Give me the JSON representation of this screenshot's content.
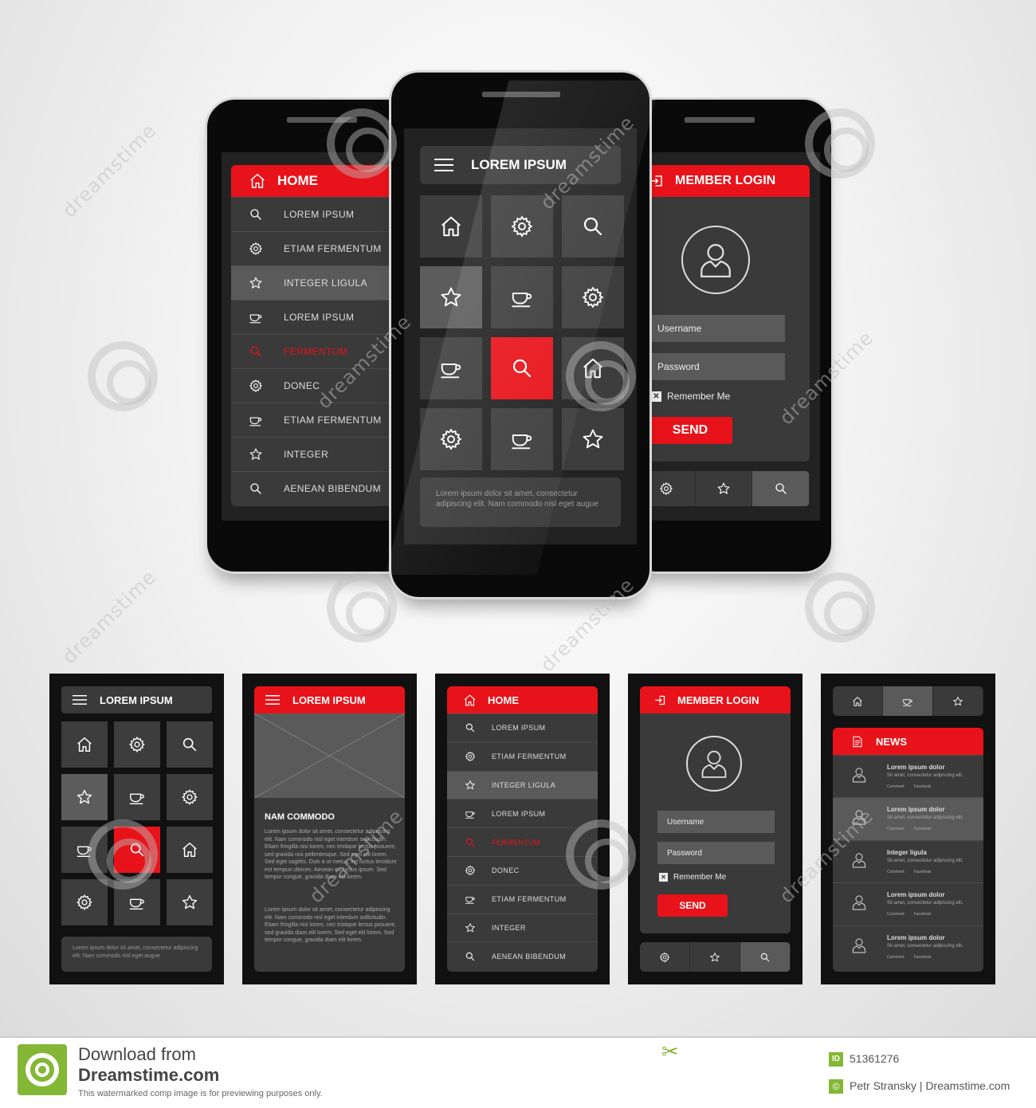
{
  "main_screen": {
    "title": "LOREM IPSUM",
    "grid_icons": [
      "home-icon",
      "gear-icon",
      "search-icon",
      "star-icon",
      "cup-icon",
      "gear-icon",
      "cup-icon",
      "search-icon",
      "home-icon",
      "gear-icon",
      "cup-icon",
      "star-icon"
    ],
    "footer_text": "Lorem ipsum dolor sit amet, consectetur adipiscing elit. Nam commodo nisl eget augue"
  },
  "home_screen": {
    "title": "HOME",
    "items": [
      {
        "label": "LOREM IPSUM",
        "icon": "search-icon"
      },
      {
        "label": "ETIAM FERMENTUM",
        "icon": "gear-icon"
      },
      {
        "label": "INTEGER LIGULA",
        "icon": "star-icon"
      },
      {
        "label": "LOREM IPSUM",
        "icon": "cup-icon"
      },
      {
        "label": "FERMENTUM",
        "icon": "search-icon"
      },
      {
        "label": "DONEC",
        "icon": "gear-icon"
      },
      {
        "label": "ETIAM FERMENTUM",
        "icon": "cup-icon"
      },
      {
        "label": "INTEGER",
        "icon": "star-icon"
      },
      {
        "label": "AENEAN BIBENDUM",
        "icon": "search-icon"
      }
    ],
    "selected_index": 2,
    "active_index": 4
  },
  "login_screen": {
    "title": "MEMBER LOGIN",
    "username_placeholder": "Username",
    "password_placeholder": "Password",
    "remember_label": "Remember Me",
    "send_label": "SEND",
    "tabs": [
      "gear-icon",
      "star-icon",
      "search-icon"
    ]
  },
  "article_screen": {
    "title": "LOREM IPSUM",
    "heading": "NAM COMMODO",
    "paragraph1": "Lorem ipsum dolor sit amet, consectetur adipiscing elit. Nam commodo nisl eget interdum sollicitudin. Etiam fringilla nisi lorem, nec tristique lectus posuere, sed gravida nisi pellentesque. Sed eget elit lorem. Sed eget sagittis. Duis a ut metus, vel luctus tincidunt est tempus ultrices. Aenean eu luctus ipsum. Sed tempor congue, gravida diam elit lorem.",
    "paragraph2": "Lorem ipsum dolor sit amet, consectetur adipiscing elit. Nam commodo nisl eget interdum sollicitudin. Etiam fringilla nisi lorem, nec tristique lectus posuere, sed gravida diam elit lorem. Sed eget elit lorem. Sed tempor congue, gravida diam elit lorem."
  },
  "news_screen": {
    "top_tabs": [
      "home-icon",
      "cup-icon",
      "star-icon"
    ],
    "title": "NEWS",
    "items": [
      {
        "title": "Lorem ipsum dolor",
        "sub": "Sit amet, consectetur adipiscing elit."
      },
      {
        "title": "Lorem ipsum dolor",
        "sub": "Sit amet, consectetur adipiscing elit."
      },
      {
        "title": "Integer ligula",
        "sub": "Sit amet, consectetur adipiscing elit."
      },
      {
        "title": "Lorem ipsum dolor",
        "sub": "Sit amet, consectetur adipiscing elit."
      },
      {
        "title": "Lorem ipsum dolor",
        "sub": "Sit amet, consectetur adipiscing elit."
      }
    ],
    "meta_comment": "Comment",
    "meta_facebook": "Facebook"
  },
  "watermark": {
    "text": "dreamstime",
    "download_line1": "Download from",
    "download_line2": "Dreamstime.com",
    "disclaimer": "This watermarked comp image is for previewing purposes only.",
    "id_badge": "ID",
    "id_value": "51361276",
    "author": "Petr Stransky | Dreamstime.com"
  },
  "colors": {
    "accent": "#e8131a",
    "dark": "#2b2b2b",
    "card": "#3a3a3a",
    "highlight": "#5a5a5a"
  }
}
